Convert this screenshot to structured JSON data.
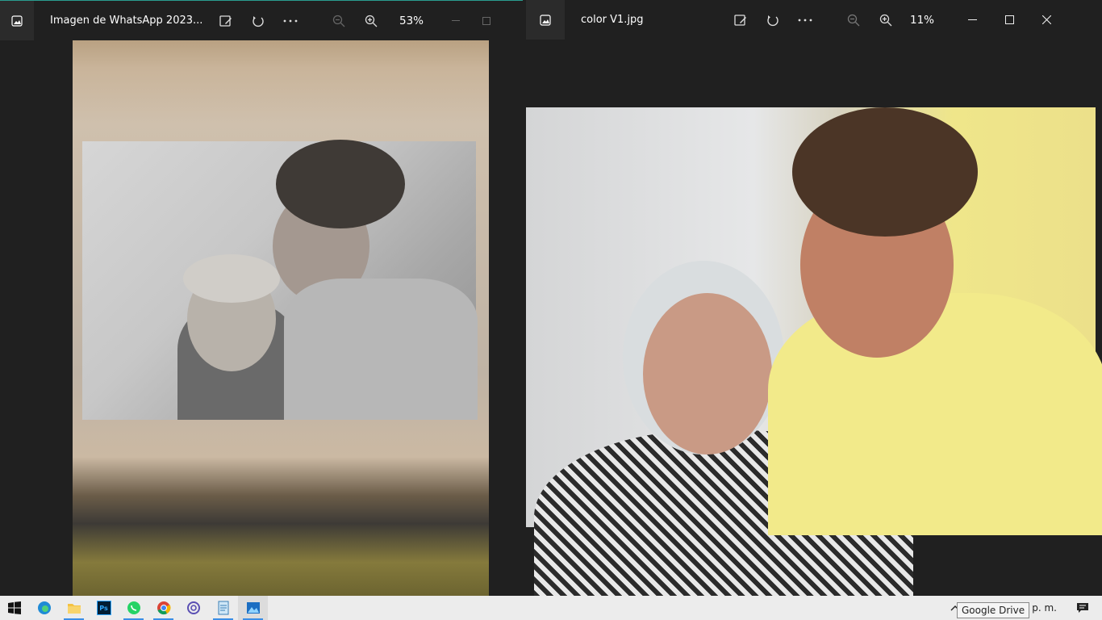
{
  "left_viewer": {
    "title": "Imagen de WhatsApp 2023...",
    "zoom": "53%"
  },
  "right_viewer": {
    "title": "color V1.jpg",
    "zoom": "11%"
  },
  "window_controls": {
    "minimize": "—",
    "maximize": "☐",
    "close": "✕"
  },
  "taskbar": {
    "apps": [
      "windows-start",
      "edge",
      "file-explorer",
      "photoshop",
      "whatsapp",
      "chrome",
      "app-swirl",
      "notepad",
      "photos"
    ],
    "ps_label": "Ps",
    "clock": "34 p. m."
  },
  "tooltip": "Google Drive",
  "colors": {
    "background": "#202020",
    "accent": "#2a9d8f",
    "taskbar": "#ececec"
  }
}
